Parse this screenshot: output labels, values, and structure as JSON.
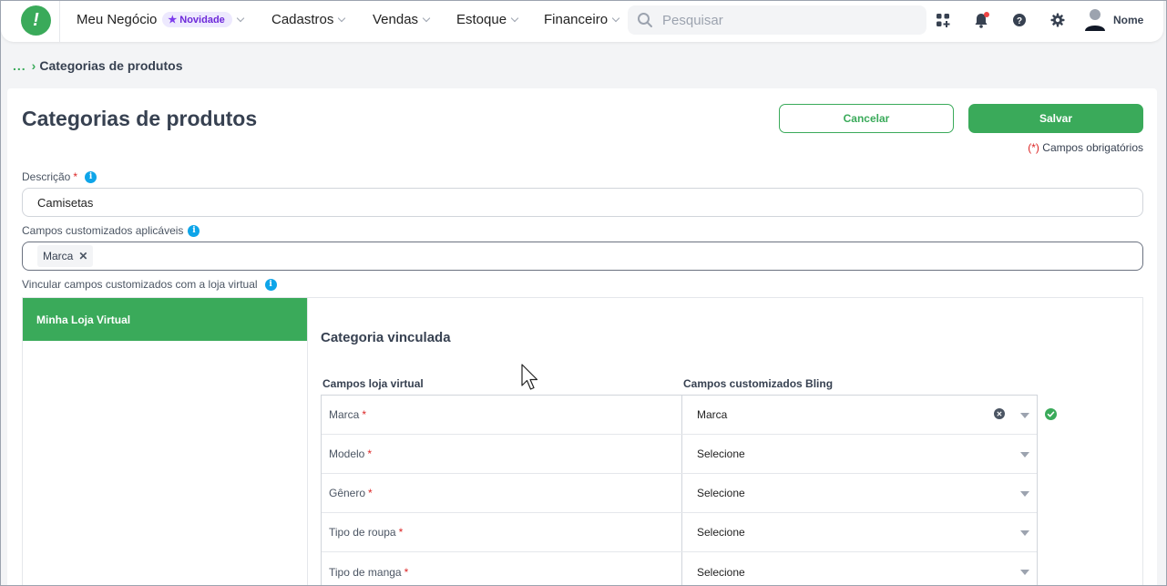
{
  "nav": {
    "business": "Meu Negócio",
    "badge": "Novidade",
    "items": [
      "Cadastros",
      "Vendas",
      "Estoque",
      "Financeiro"
    ],
    "search_placeholder": "Pesquisar",
    "user_name": "Nome"
  },
  "breadcrumb": {
    "dots": "...",
    "current": "Categorias de produtos"
  },
  "page": {
    "title": "Categorias de produtos",
    "cancel_label": "Cancelar",
    "save_label": "Salvar",
    "required_mark": "(*)",
    "required_note": " Campos obrigatórios"
  },
  "form": {
    "description_label": "Descrição",
    "description_value": "Camisetas",
    "custom_fields_label": "Campos customizados aplicáveis",
    "custom_field_tags": [
      "Marca"
    ],
    "link_label": "Vincular campos customizados com a loja virtual"
  },
  "store": {
    "tab_label": "Minha Loja Virtual",
    "section_title": "Categoria vinculada",
    "col_store": "Campos loja virtual",
    "col_bling": "Campos customizados Bling",
    "rows": [
      {
        "field": "Marca",
        "value": "Marca"
      },
      {
        "field": "Modelo",
        "value": "Selecione"
      },
      {
        "field": "Gênero",
        "value": "Selecione"
      },
      {
        "field": "Tipo de roupa",
        "value": "Selecione"
      },
      {
        "field": "Tipo de manga",
        "value": "Selecione"
      }
    ]
  },
  "colors": {
    "brand": "#3aaa5a",
    "info": "#0ea5e9",
    "required": "#dc2626"
  }
}
